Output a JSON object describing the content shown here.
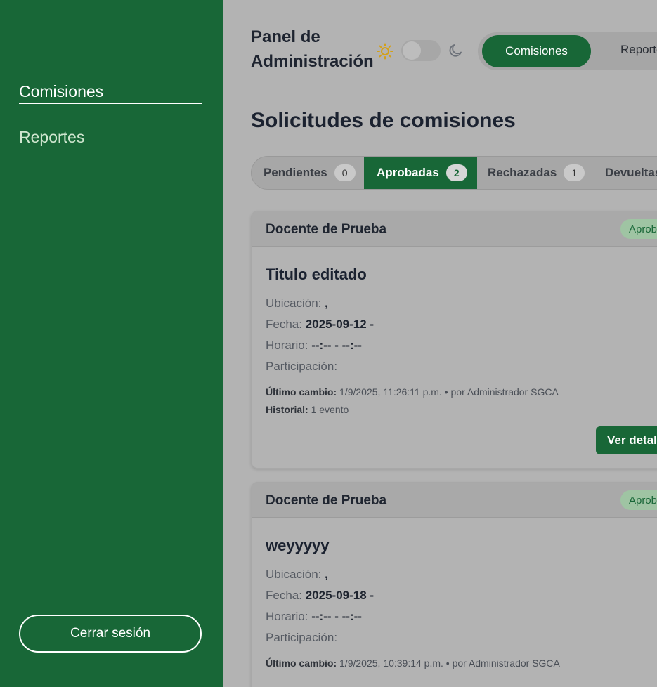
{
  "sidebar": {
    "items": [
      {
        "label": "Comisiones"
      },
      {
        "label": "Reportes"
      }
    ],
    "logout_label": "Cerrar sesión"
  },
  "header": {
    "title_line1": "Panel de",
    "title_line2": "Administración",
    "nav": [
      {
        "label": "Comisiones"
      },
      {
        "label": "Reportes"
      }
    ]
  },
  "page": {
    "heading": "Solicitudes de comisiones"
  },
  "tabs": [
    {
      "label": "Pendientes",
      "count": "0"
    },
    {
      "label": "Aprobadas",
      "count": "2"
    },
    {
      "label": "Rechazadas",
      "count": "1"
    },
    {
      "label": "Devueltas",
      "count": ""
    }
  ],
  "labels": {
    "ubicacion": "Ubicación:",
    "fecha": "Fecha:",
    "horario": "Horario:",
    "participacion": "Participación:",
    "ultimo_cambio": "Último cambio:",
    "historial": "Historial:",
    "ver_detalle": "Ver detalle"
  },
  "cards": [
    {
      "teacher": "Docente de Prueba",
      "status": "Aprobada",
      "title": "Titulo editado",
      "ubicacion": ",",
      "fecha": "2025-09-12 -",
      "horario": "--:-- - --:--",
      "participacion": "",
      "ultimo_cambio": "1/9/2025, 11:26:11 p.m. • por Administrador SGCA",
      "historial": "1 evento"
    },
    {
      "teacher": "Docente de Prueba",
      "status": "Aprobada",
      "title": "weyyyyy",
      "ubicacion": ",",
      "fecha": "2025-09-18 -",
      "horario": "--:-- - --:--",
      "participacion": "",
      "ultimo_cambio": "1/9/2025, 10:39:14 p.m. • por Administrador SGCA"
    }
  ],
  "colors": {
    "brand_green": "#186737",
    "overlay_gray": "#b3b3b3"
  }
}
